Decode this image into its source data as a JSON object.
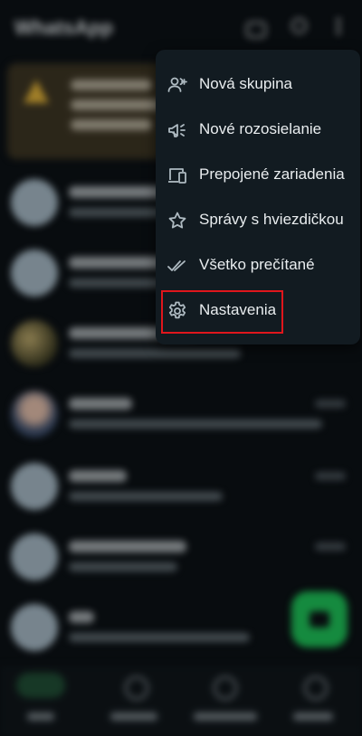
{
  "menu": {
    "items": [
      {
        "label": "Nová skupina",
        "icon": "new-group-icon"
      },
      {
        "label": "Nové rozosielanie",
        "icon": "broadcast-icon"
      },
      {
        "label": "Prepojené zariadenia",
        "icon": "linked-devices-icon"
      },
      {
        "label": "Správy s hviezdičkou",
        "icon": "star-icon"
      },
      {
        "label": "Všetko prečítané",
        "icon": "double-check-icon"
      },
      {
        "label": "Nastavenia",
        "icon": "gear-icon",
        "highlighted": true
      }
    ]
  },
  "colors": {
    "accent": "#1db954",
    "menu_bg": "#121b21",
    "highlight": "#e0161c"
  }
}
